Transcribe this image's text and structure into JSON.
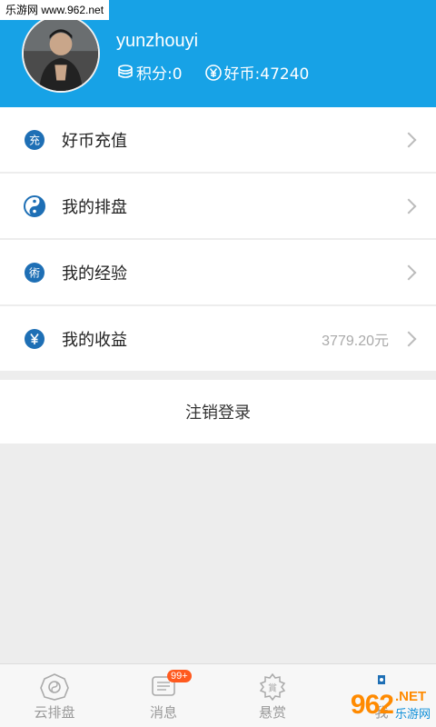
{
  "watermark": {
    "site": "乐游网 www.962.net",
    "brand_num": "962",
    "brand_net": ".NET",
    "brand_cn": "乐游网"
  },
  "profile": {
    "username": "yunzhouyi",
    "points_label": "积分:0",
    "coins_label": "好币:47240"
  },
  "menu": {
    "items": [
      {
        "label": "好币充值",
        "icon": "recharge-icon",
        "value": ""
      },
      {
        "label": "我的排盘",
        "icon": "taiji-icon",
        "value": ""
      },
      {
        "label": "我的经验",
        "icon": "skill-icon",
        "value": ""
      },
      {
        "label": "我的收益",
        "icon": "yuan-icon",
        "value": "3779.20元"
      }
    ]
  },
  "logout": {
    "label": "注销登录"
  },
  "tabbar": {
    "tabs": [
      {
        "label": "云排盘",
        "icon": "bagua-icon"
      },
      {
        "label": "消息",
        "icon": "message-icon",
        "badge": "99+"
      },
      {
        "label": "悬赏",
        "icon": "reward-icon"
      },
      {
        "label": "我",
        "icon": "me-icon"
      }
    ]
  },
  "colors": {
    "header": "#17a2e6",
    "icon_blue": "#1e6fb5",
    "badge": "#ff5a1f"
  }
}
